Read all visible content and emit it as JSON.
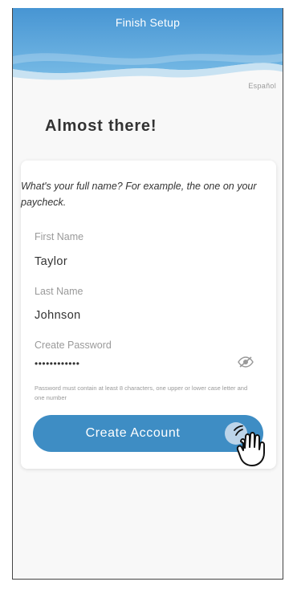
{
  "header": {
    "title": "Finish Setup",
    "gradient_top": "#4a9bd6",
    "gradient_bottom": "#73b6e3"
  },
  "language_link": "Español",
  "heading": "Almost there!",
  "form": {
    "prompt": "What's your full name? For example, the one on your paycheck.",
    "first_name": {
      "label": "First Name",
      "value": "Taylor"
    },
    "last_name": {
      "label": "Last Name",
      "value": "Johnson"
    },
    "password": {
      "label": "Create Password",
      "value": "••••••••••••",
      "toggle_icon": "eye-slash-icon",
      "hint": "Password must contain at least 8 characters, one upper or lower case letter and one number"
    },
    "submit_label": "Create Account",
    "accent_color": "#3e8dc4"
  },
  "pointer_icon": "hand-pointer-icon"
}
